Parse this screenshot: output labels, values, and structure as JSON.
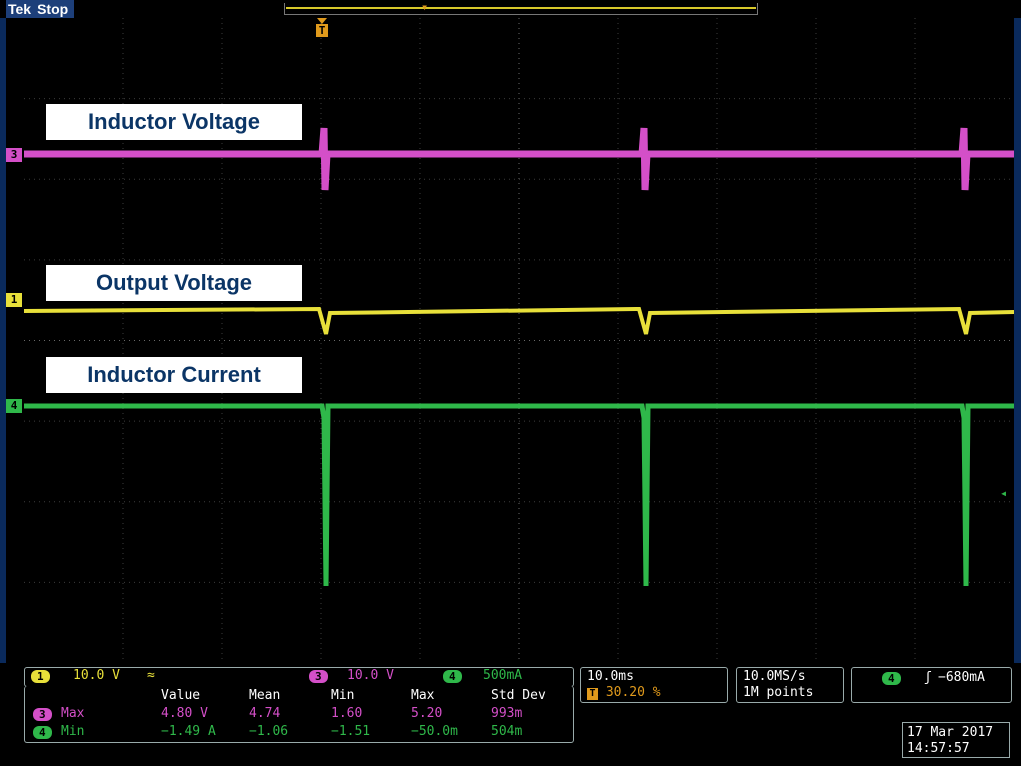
{
  "header": {
    "brand": "Tek",
    "status": "Stop",
    "trigger_marker": "T"
  },
  "labels": {
    "inductor_voltage": "Inductor Voltage",
    "output_voltage": "Output Voltage",
    "inductor_current": "Inductor Current"
  },
  "channels": {
    "ch3": {
      "number": "3",
      "color": "#d44fc8",
      "scale": "10.0 V"
    },
    "ch1": {
      "number": "1",
      "color": "#e8e03a",
      "scale": "10.0 V",
      "coupling": "≈"
    },
    "ch4": {
      "number": "4",
      "color": "#2fb84a",
      "scale": "500mA"
    }
  },
  "timebase": {
    "per_div": "10.0ms",
    "trigger_position": "30.20 %"
  },
  "acquisition": {
    "sample_rate": "10.0MS/s",
    "record_length": "1M points"
  },
  "trigger": {
    "channel": "4",
    "edge": "ʃ",
    "level": "−680mA"
  },
  "measurements": {
    "headers": [
      "Value",
      "Mean",
      "Min",
      "Max",
      "Std Dev"
    ],
    "rows": [
      {
        "channel": "3",
        "label": "Max",
        "values": [
          "4.80 V",
          "4.74",
          "1.60",
          "5.20",
          "993m"
        ]
      },
      {
        "channel": "4",
        "label": "Min",
        "values": [
          "−1.49 A",
          "−1.06",
          "−1.51",
          "−50.0m",
          "504m"
        ]
      }
    ]
  },
  "datetime": {
    "date": "17 Mar 2017",
    "time": "14:57:57"
  }
}
